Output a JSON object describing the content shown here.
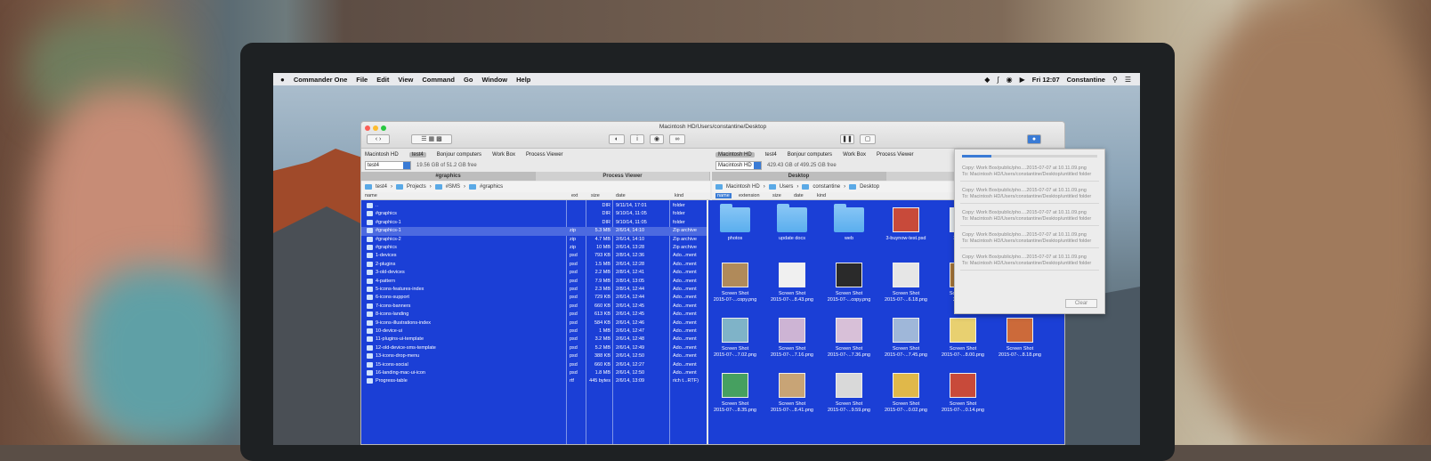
{
  "menubar": {
    "app_name": "Commander One",
    "menus": [
      "File",
      "Edit",
      "View",
      "Command",
      "Go",
      "Window",
      "Help"
    ],
    "clock": "Fri 12:07",
    "user": "Constantine"
  },
  "window": {
    "title": "Macintosh HD/Users/constantine/Desktop"
  },
  "left_panel": {
    "tabs": [
      "Macintosh HD",
      "test4",
      "Bonjour computers",
      "Work Box",
      "Process Viewer"
    ],
    "active_tab": 1,
    "drive": "test4",
    "free_space": "19.56 GB of 51.2 GB free",
    "tabstrip": [
      "#graphics",
      "Process Viewer"
    ],
    "breadcrumb": [
      "test4",
      "Projects",
      "#SMS",
      "#graphics"
    ],
    "columns": [
      "name",
      "ext",
      "size",
      "date",
      "kind"
    ],
    "rows": [
      {
        "name": "..",
        "ext": "",
        "size": "DIR",
        "date": "9/11/14, 17:01",
        "kind": "folder"
      },
      {
        "name": "#graphics",
        "ext": "",
        "size": "DIR",
        "date": "9/10/14, 11:05",
        "kind": "folder"
      },
      {
        "name": "#graphics-1",
        "ext": "",
        "size": "DIR",
        "date": "9/10/14, 11:05",
        "kind": "folder"
      },
      {
        "name": "#graphics-1",
        "ext": "zip",
        "size": "5.3 MB",
        "date": "2/6/14, 14:10",
        "kind": "Zip archive"
      },
      {
        "name": "#graphics-2",
        "ext": "zip",
        "size": "4.7 MB",
        "date": "2/6/14, 14:10",
        "kind": "Zip archive"
      },
      {
        "name": "#graphics",
        "ext": "zip",
        "size": "10 MB",
        "date": "2/6/14, 13:28",
        "kind": "Zip archive"
      },
      {
        "name": "1-devices",
        "ext": "psd",
        "size": "793 KB",
        "date": "2/8/14, 12:36",
        "kind": "Ado...ment"
      },
      {
        "name": "2-plugins",
        "ext": "psd",
        "size": "1.5 MB",
        "date": "2/6/14, 12:28",
        "kind": "Ado...ment"
      },
      {
        "name": "3-old-devices",
        "ext": "psd",
        "size": "2.2 MB",
        "date": "2/8/14, 12:41",
        "kind": "Ado...ment"
      },
      {
        "name": "4-pattern",
        "ext": "psd",
        "size": "7.9 MB",
        "date": "2/8/14, 13:05",
        "kind": "Ado...ment"
      },
      {
        "name": "5-icons-features-index",
        "ext": "psd",
        "size": "2.3 MB",
        "date": "2/8/14, 12:44",
        "kind": "Ado...ment"
      },
      {
        "name": "6-icons-support",
        "ext": "psd",
        "size": "729 KB",
        "date": "2/6/14, 12:44",
        "kind": "Ado...ment"
      },
      {
        "name": "7-icons-banners",
        "ext": "psd",
        "size": "660 KB",
        "date": "2/6/14, 12:45",
        "kind": "Ado...ment"
      },
      {
        "name": "8-icons-landing",
        "ext": "psd",
        "size": "613 KB",
        "date": "2/6/14, 12:45",
        "kind": "Ado...ment"
      },
      {
        "name": "9-icons-illustrations-index",
        "ext": "psd",
        "size": "584 KB",
        "date": "2/6/14, 12:46",
        "kind": "Ado...ment"
      },
      {
        "name": "10-device-ui",
        "ext": "psd",
        "size": "1 MB",
        "date": "2/6/14, 12:47",
        "kind": "Ado...ment"
      },
      {
        "name": "11-plugins-ui-template",
        "ext": "psd",
        "size": "3.2 MB",
        "date": "2/6/14, 12:48",
        "kind": "Ado...ment"
      },
      {
        "name": "12-old-device-sms-template",
        "ext": "psd",
        "size": "5.2 MB",
        "date": "2/6/14, 12:49",
        "kind": "Ado...ment"
      },
      {
        "name": "13-icons-drop-menu",
        "ext": "psd",
        "size": "388 KB",
        "date": "2/6/14, 12:50",
        "kind": "Ado...ment"
      },
      {
        "name": "15-icons-social",
        "ext": "psd",
        "size": "660 KB",
        "date": "2/6/14, 12:27",
        "kind": "Ado...ment"
      },
      {
        "name": "16-landing-mac-ui-icon",
        "ext": "psd",
        "size": "1.8 MB",
        "date": "2/6/14, 12:50",
        "kind": "Ado...ment"
      },
      {
        "name": "Progress-table",
        "ext": "rtf",
        "size": "445 bytes",
        "date": "2/6/14, 13:09",
        "kind": "rich t...RTF)"
      }
    ],
    "selected_row": 3
  },
  "right_panel": {
    "tabs": [
      "Macintosh HD",
      "test4",
      "Bonjour computers",
      "Work Box",
      "Process Viewer"
    ],
    "active_tab": 0,
    "drive": "Macintosh HD",
    "free_space": "429.43 GB of 499.25 GB free",
    "tabstrip": [
      "Desktop",
      "Bonjour"
    ],
    "breadcrumb": [
      "Macintosh HD",
      "Users",
      "constantine",
      "Desktop"
    ],
    "columns": [
      "name",
      "extension",
      "size",
      "date",
      "kind"
    ],
    "items": [
      {
        "label1": "photos",
        "label2": "",
        "type": "folder"
      },
      {
        "label1": "update docs",
        "label2": "",
        "type": "folder"
      },
      {
        "label1": "web",
        "label2": "",
        "type": "folder"
      },
      {
        "label1": "3-buynow-test.psd",
        "label2": "",
        "type": "file"
      },
      {
        "label1": "3-c1-buy",
        "label2": "",
        "type": "file"
      },
      {
        "label1": "Screen Shot",
        "label2": "2015-07-...copy.png",
        "type": "shot"
      },
      {
        "label1": "Screen Shot",
        "label2": "2015-07-...8.43.png",
        "type": "shot"
      },
      {
        "label1": "Screen Shot",
        "label2": "2015-07-...copy.png",
        "type": "shot"
      },
      {
        "label1": "Screen Shot",
        "label2": "2015-07-...6.18.png",
        "type": "shot"
      },
      {
        "label1": "Screen Shot",
        "label2": "2015-07-",
        "type": "shot"
      },
      {
        "label1": "Screen Shot",
        "label2": "2015-07-...1.41.png",
        "type": "shot"
      },
      {
        "label1": "Screen Shot",
        "label2": "2015-07-...7.02.png",
        "type": "shot"
      },
      {
        "label1": "Screen Shot",
        "label2": "2015-07-...7.16.png",
        "type": "shot"
      },
      {
        "label1": "Screen Shot",
        "label2": "2015-07-...7.36.png",
        "type": "shot"
      },
      {
        "label1": "Screen Shot",
        "label2": "2015-07-...7.45.png",
        "type": "shot"
      },
      {
        "label1": "Screen Shot",
        "label2": "2015-07-...8.00.png",
        "type": "shot"
      },
      {
        "label1": "Screen Shot",
        "label2": "2015-07-...8.18.png",
        "type": "shot"
      },
      {
        "label1": "Screen Shot",
        "label2": "2015-07-...8.35.png",
        "type": "shot"
      },
      {
        "label1": "Screen Shot",
        "label2": "2015-07-...8.41.png",
        "type": "shot"
      },
      {
        "label1": "Screen Shot",
        "label2": "2015-07-...9.59.png",
        "type": "shot"
      },
      {
        "label1": "Screen Shot",
        "label2": "2015-07-...0.02.png",
        "type": "shot"
      },
      {
        "label1": "Screen Shot",
        "label2": "2015-07-...0.14.png",
        "type": "shot"
      }
    ]
  },
  "operations": {
    "progress": 0.22,
    "items": [
      {
        "line1": "Copy: Work Box/public/pho....2015-07-07 at 10.11.09.png",
        "line2": "To: Macintosh HD/Users/constantine/Desktop/untitled folder"
      },
      {
        "line1": "Copy: Work Box/public/pho....2015-07-07 at 10.11.09.png",
        "line2": "To: Macintosh HD/Users/constantine/Desktop/untitled folder"
      },
      {
        "line1": "Copy: Work Box/public/pho....2015-07-07 at 10.11.09.png",
        "line2": "To: Macintosh HD/Users/constantine/Desktop/untitled folder"
      },
      {
        "line1": "Copy: Work Box/public/pho....2015-07-07 at 10.11.09.png",
        "line2": "To: Macintosh HD/Users/constantine/Desktop/untitled folder"
      },
      {
        "line1": "Copy: Work Box/public/pho....2015-07-07 at 10.11.09.png",
        "line2": "To: Macintosh HD/Users/constantine/Desktop/untitled folder"
      }
    ],
    "clear_label": "Clear"
  },
  "colors": {
    "selection_blue": "#1b3fd6",
    "accent": "#3a7bd5",
    "folder": "#5aa9e6"
  }
}
